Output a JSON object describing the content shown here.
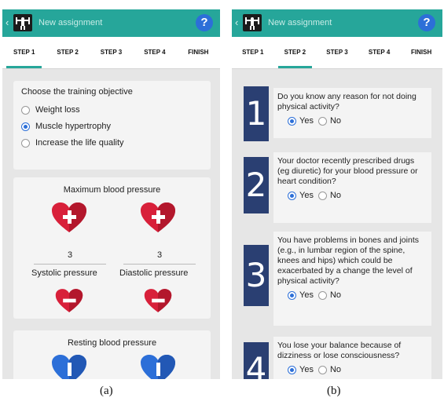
{
  "app": {
    "title": "New assignment",
    "help_label": "?"
  },
  "tabs": [
    "STEP 1",
    "STEP 2",
    "STEP 3",
    "STEP 4",
    "FINISH"
  ],
  "screen_a": {
    "active_tab": 0,
    "objective": {
      "title": "Choose the training objective",
      "options": [
        {
          "label": "Weight loss",
          "selected": false
        },
        {
          "label": "Muscle hypertrophy",
          "selected": true
        },
        {
          "label": "Increase the life quality",
          "selected": false
        }
      ]
    },
    "max_bp": {
      "title": "Maximum blood pressure",
      "systolic_value": "3",
      "diastolic_value": "3",
      "systolic_label": "Systolic pressure",
      "diastolic_label": "Diastolic pressure"
    },
    "resting_bp": {
      "title": "Resting blood pressure"
    }
  },
  "screen_b": {
    "active_tab": 1,
    "questions": [
      {
        "number": "1",
        "text": "Do you know any reason for not doing physical activity?",
        "yes": "Yes",
        "no": "No",
        "answer": "yes"
      },
      {
        "number": "2",
        "text": "Your doctor recently prescribed drugs (eg diuretic) for your blood pressure or heart condition?",
        "yes": "Yes",
        "no": "No",
        "answer": "yes"
      },
      {
        "number": "3",
        "text": "You have problems in bones and joints (e.g., in lumbar region of the spine, knees and hips) which could be exacerbated by a change the level of physical activity?",
        "yes": "Yes",
        "no": "No",
        "answer": "yes"
      },
      {
        "number": "4",
        "text": "You lose your balance because of dizziness or lose consciousness?",
        "yes": "Yes",
        "no": "No",
        "answer": "yes"
      }
    ]
  },
  "captions": {
    "a": "(a)",
    "b": "(b)"
  },
  "colors": {
    "appbar": "#26a69a",
    "help": "#2c6fd8",
    "heart_red": "#d8203a",
    "heart_blue": "#2c6fd8",
    "number_box": "#2a3f72"
  }
}
